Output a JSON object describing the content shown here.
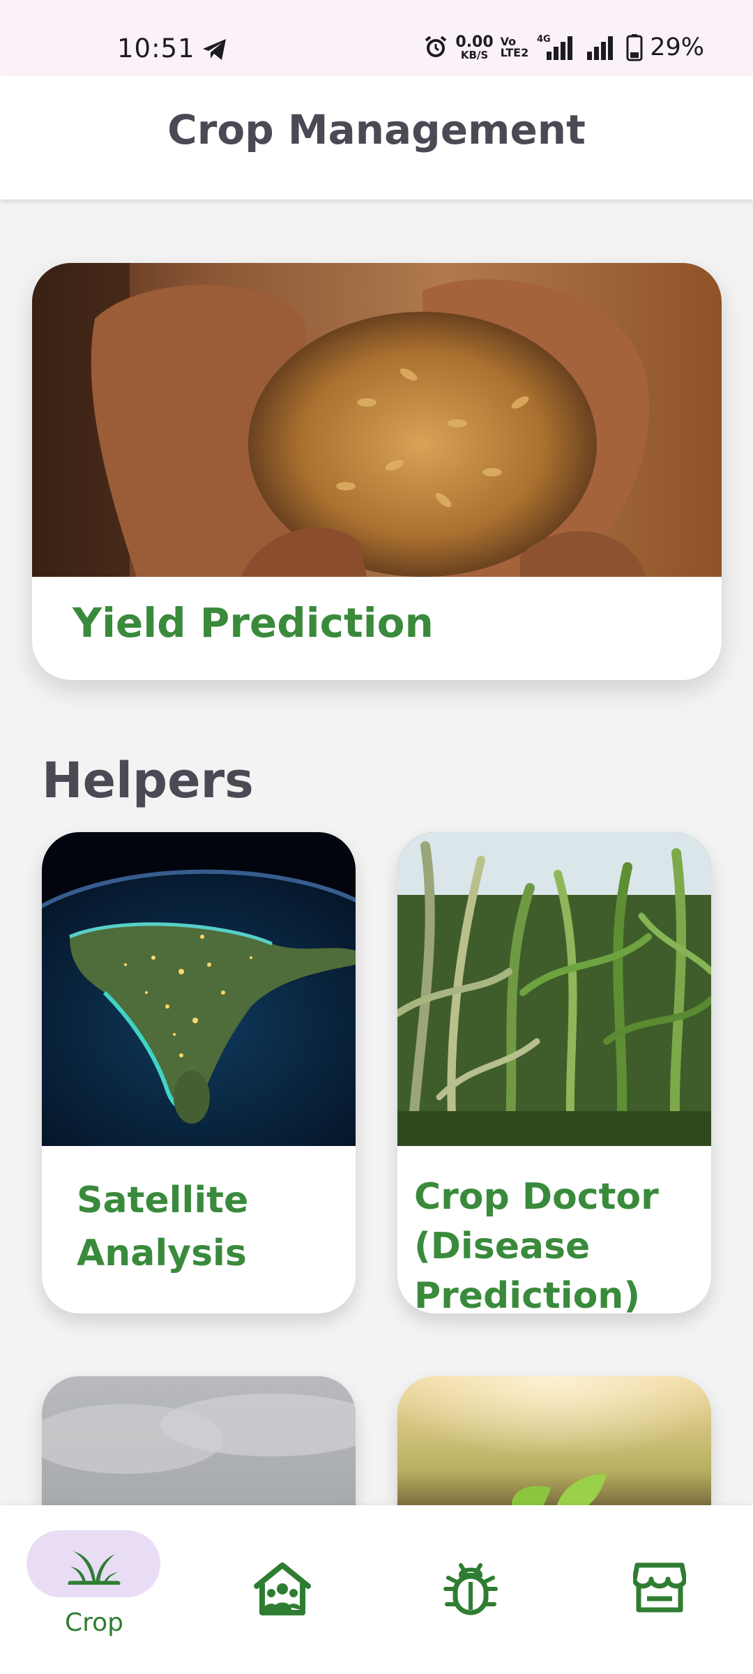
{
  "status_bar": {
    "time": "10:51",
    "data_speed_value": "0.00",
    "data_speed_unit": "KB/S",
    "volte_top": "Vo",
    "volte_bottom": "LTE2",
    "network": "4G",
    "battery": "29%"
  },
  "header": {
    "title": "Crop Management"
  },
  "hero": {
    "title": "Yield Prediction",
    "image": "grain-in-hands-photo"
  },
  "helpers": {
    "heading": "Helpers",
    "tiles": [
      {
        "title_line1": "Satellite",
        "title_line2": "Analysis",
        "image": "earth-at-night-india-photo"
      },
      {
        "title_line1": "Crop Doctor",
        "title_line2": "(Disease",
        "title_line3": "Prediction)",
        "image": "corn-field-photo"
      },
      {
        "image": "cloudy-sky-photo"
      },
      {
        "image": "seedling-sunset-photo"
      }
    ]
  },
  "bottom_nav": {
    "items": [
      {
        "label": "Crop",
        "icon": "sprout-icon",
        "active": true
      },
      {
        "icon": "community-home-icon"
      },
      {
        "icon": "bug-icon"
      },
      {
        "icon": "store-icon"
      }
    ]
  },
  "colors": {
    "accent_green": "#3a8a3c",
    "title_gray": "#4a4a55",
    "active_pill": "#e9ddf6",
    "status_bar_bg": "#fbf1f8"
  }
}
